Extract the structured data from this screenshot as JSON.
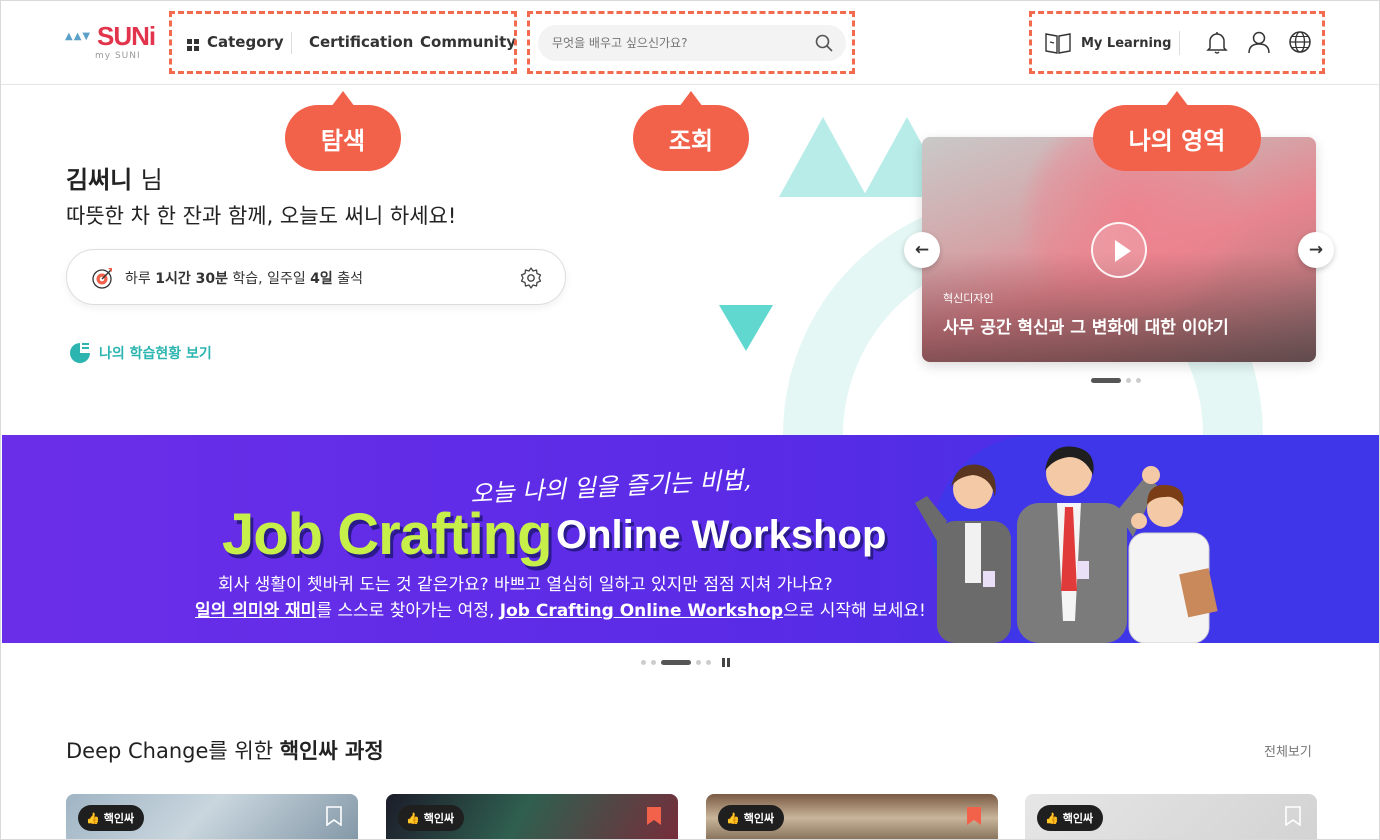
{
  "header": {
    "logo_text": "SUNi",
    "logo_sub": "my SUNI",
    "nav": {
      "category": "Category",
      "certification": "Certification",
      "community": "Community"
    },
    "search_placeholder": "무엇을 배우고 싶으신가요?",
    "my_learning": "My Learning"
  },
  "callouts": {
    "explore": "탐색",
    "search": "조회",
    "my_area": "나의 영역"
  },
  "hero": {
    "user_name": "김써니",
    "honorific": "님",
    "message": "따뜻한 차 한 잔과 함께, 오늘도 써니 하세요!",
    "study_goal": {
      "prefix": "하루 ",
      "time": "1시간 30분",
      "mid": " 학습, 일주일 ",
      "days": "4일",
      "suffix": " 출석"
    },
    "status_link": "나의 학습현황 보기",
    "featured": {
      "category": "혁신디자인",
      "title": "사무 공간 혁신과 그 변화에 대한 이야기"
    }
  },
  "banner": {
    "script": "오늘 나의 일을 즐기는 비법,",
    "title_main": "Job Crafting",
    "title_sub": "Online Workshop",
    "line1": "회사 생활이 쳇바퀴 도는 것 같은가요? 바쁘고 열심히 일하고 있지만 점점 지쳐 가나요?",
    "line2_u1": "일의 의미와 재미",
    "line2_mid": "를 스스로 찾아가는 여정, ",
    "line2_u2": "Job Crafting Online Workshop",
    "line2_end": "으로 시작해 보세요!"
  },
  "section": {
    "title_prefix": "Deep Change를 위한 ",
    "title_bold": "핵인싸 과정",
    "view_all": "전체보기",
    "course_badge": "핵인싸",
    "cards": [
      {
        "bookmarked": false
      },
      {
        "bookmarked": true
      },
      {
        "bookmarked": true
      },
      {
        "bookmarked": false
      }
    ]
  },
  "colors": {
    "accent": "#f2614a",
    "teal": "#2cb5b0",
    "brand_red": "#e2344c",
    "banner": "#5a2be6",
    "lime": "#c7ef4a"
  }
}
